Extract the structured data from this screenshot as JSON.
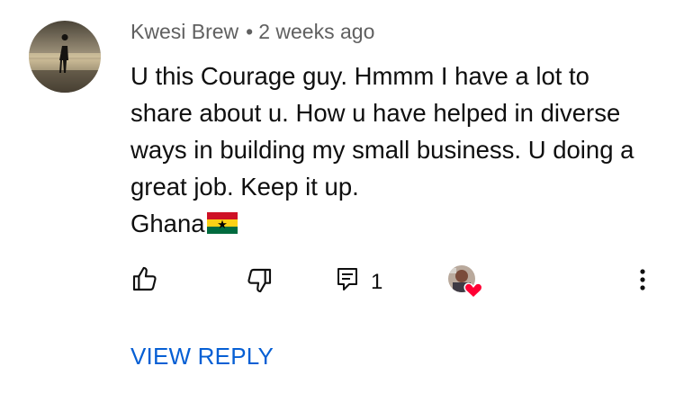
{
  "author": {
    "name": "Kwesi Brew",
    "time": "2 weeks ago"
  },
  "comment": {
    "lines": [
      "U this Courage guy. Hmmm I have a lot to",
      "share about u. How u have helped in diverse",
      "ways in building my small business. U doing a",
      "great job. Keep it up."
    ],
    "last_line": "Ghana",
    "emoji": "ghana-flag"
  },
  "actions": {
    "reply_count": "1",
    "creator_heart": true
  },
  "view_reply_label": "VIEW REPLY",
  "colors": {
    "link": "#065fd4",
    "meta": "#606060",
    "text": "#0f0f0f",
    "heart": "#ff0033"
  }
}
